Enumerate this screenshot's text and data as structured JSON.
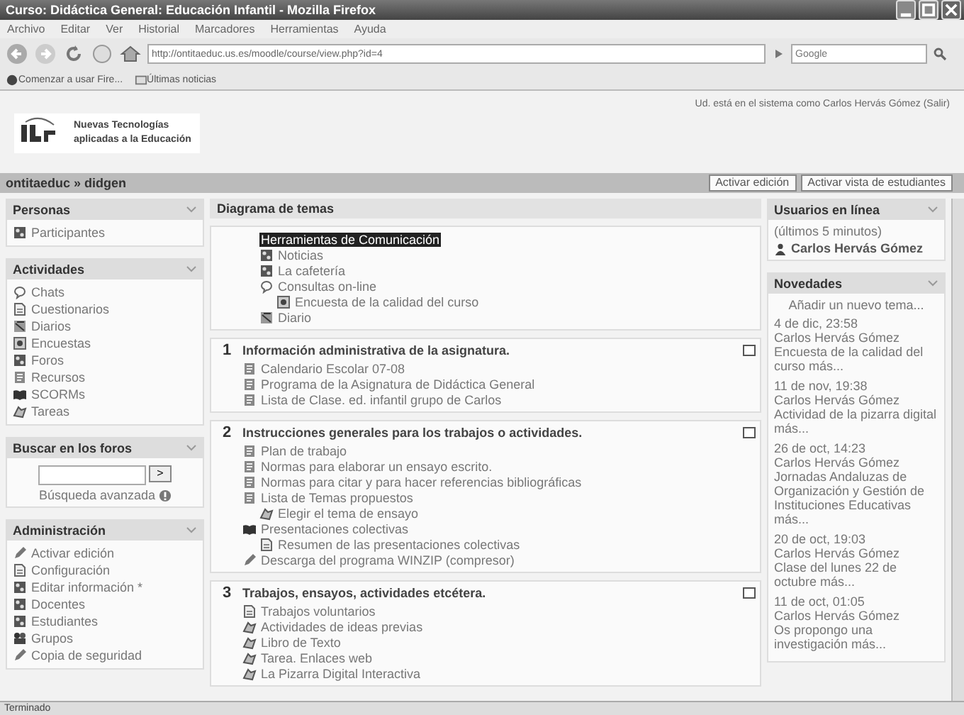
{
  "window": {
    "title": "Curso: Didáctica General: Educación Infantil - Mozilla Firefox"
  },
  "menu": [
    "Archivo",
    "Editar",
    "Ver",
    "Historial",
    "Marcadores",
    "Herramientas",
    "Ayuda"
  ],
  "address": {
    "value": "http://ontitaeduc.us.es/moodle/course/view.php?id=4"
  },
  "search": {
    "placeholder": "Google"
  },
  "bookmarks": [
    "Comenzar a usar Fire...",
    "Últimas noticias"
  ],
  "site": {
    "name_lines": [
      "Nuevas Tecnologías",
      "aplicadas a la Educación"
    ],
    "login": "Ud. está en el sistema como Carlos Hervás Gómez (Salir)"
  },
  "breadcrumb": "ontitaeduc » didgen",
  "buttons": [
    "Activar edición",
    "Activar vista de estudiantes"
  ],
  "left_blocks": [
    {
      "title": "Personas",
      "kind": "list",
      "items": [
        {
          "label": "Participantes",
          "kind": "people"
        }
      ]
    },
    {
      "title": "Actividades",
      "kind": "list",
      "items": [
        {
          "label": "Chats",
          "kind": "chat"
        },
        {
          "label": "Cuestionarios",
          "kind": "quiz"
        },
        {
          "label": "Diarios",
          "kind": "journal"
        },
        {
          "label": "Encuestas",
          "kind": "survey"
        },
        {
          "label": "Foros",
          "kind": "people"
        },
        {
          "label": "Recursos",
          "kind": "resource"
        },
        {
          "label": "SCORMs",
          "kind": "scorm"
        },
        {
          "label": "Tareas",
          "kind": "assignment"
        }
      ]
    },
    {
      "title": "Buscar en los foros",
      "kind": "search",
      "go": ">",
      "link": "Búsqueda avanzada"
    },
    {
      "title": "Administración",
      "kind": "list",
      "items": [
        {
          "label": "Activar edición",
          "kind": "edit"
        },
        {
          "label": "Configuración",
          "kind": "quiz"
        },
        {
          "label": "Editar información *",
          "kind": "people"
        },
        {
          "label": "Docentes",
          "kind": "people"
        },
        {
          "label": "Estudiantes",
          "kind": "people"
        },
        {
          "label": "Grupos",
          "kind": "groups"
        },
        {
          "label": "Copia de seguridad",
          "kind": "edit"
        }
      ]
    }
  ],
  "center": {
    "title": "Diagrama de temas",
    "sections": [
      {
        "items": [
          {
            "label": "Herramientas de Comunicación",
            "kind": "label"
          },
          {
            "label": "Noticias",
            "kind": "people"
          },
          {
            "label": "La cafetería",
            "kind": "people"
          },
          {
            "label": "Consultas on-line",
            "kind": "chat",
            "children": [
              {
                "label": "Encuesta de la calidad del curso",
                "kind": "survey"
              }
            ]
          },
          {
            "label": "Diario",
            "kind": "journal"
          }
        ]
      },
      {
        "number": "1",
        "heading": "Información administrativa de la asignatura.",
        "items": [
          {
            "label": "Calendario Escolar 07-08",
            "kind": "resource"
          },
          {
            "label": "Programa de la Asignatura de Didáctica General",
            "kind": "resource"
          },
          {
            "label": "Lista de Clase. ed. infantil grupo de Carlos",
            "kind": "resource"
          }
        ]
      },
      {
        "number": "2",
        "heading": "Instrucciones generales para los trabajos o actividades.",
        "items": [
          {
            "label": "Plan de trabajo",
            "kind": "resource"
          },
          {
            "label": "Normas para elaborar un ensayo escrito.",
            "kind": "resource"
          },
          {
            "label": "Normas para citar y para hacer referencias bibliográficas",
            "kind": "resource"
          },
          {
            "label": "Lista de Temas propuestos",
            "kind": "resource",
            "children": [
              {
                "label": "Elegir el tema de ensayo",
                "kind": "assignment"
              }
            ]
          },
          {
            "label": "Presentaciones colectivas",
            "kind": "scorm",
            "children": [
              {
                "label": "Resumen de las presentaciones colectivas",
                "kind": "quiz"
              }
            ]
          },
          {
            "label": "Descarga del programa WINZIP (compresor)",
            "kind": "edit"
          }
        ]
      },
      {
        "number": "3",
        "heading": "Trabajos, ensayos, actividades etcétera.",
        "items": [
          {
            "label": "Trabajos voluntarios",
            "kind": "quiz"
          },
          {
            "label": "Actividades de ideas previas",
            "kind": "assignment"
          },
          {
            "label": "Libro de Texto",
            "kind": "assignment"
          },
          {
            "label": "Tarea. Enlaces web",
            "kind": "assignment"
          },
          {
            "label": "La Pizarra Digital Interactiva",
            "kind": "assignment"
          }
        ]
      }
    ]
  },
  "online": {
    "title": "Usuarios en línea",
    "note": "(últimos 5 minutos)",
    "users": [
      "Carlos Hervás Gómez"
    ]
  },
  "news": {
    "title": "Novedades",
    "add": "Añadir un nuevo tema...",
    "posts": [
      {
        "date": "4 de dic, 23:58",
        "author": "Carlos Hervás Gómez",
        "text": "Encuesta de la calidad del curso más..."
      },
      {
        "date": "11 de nov, 19:38",
        "author": "Carlos Hervás Gómez",
        "text": "Actividad de la pizarra digital más..."
      },
      {
        "date": "26 de oct, 14:23",
        "author": "Carlos Hervás Gómez",
        "text": "Jornadas Andaluzas de Organización y Gestión de Instituciones Educativas más..."
      },
      {
        "date": "20 de oct, 19:03",
        "author": "Carlos Hervás Gómez",
        "text": "Clase del lunes 22 de octubre más..."
      },
      {
        "date": "11 de oct, 01:05",
        "author": "Carlos Hervás Gómez",
        "text": "Os propongo una investigación más..."
      }
    ]
  },
  "status_bar": "Terminado"
}
